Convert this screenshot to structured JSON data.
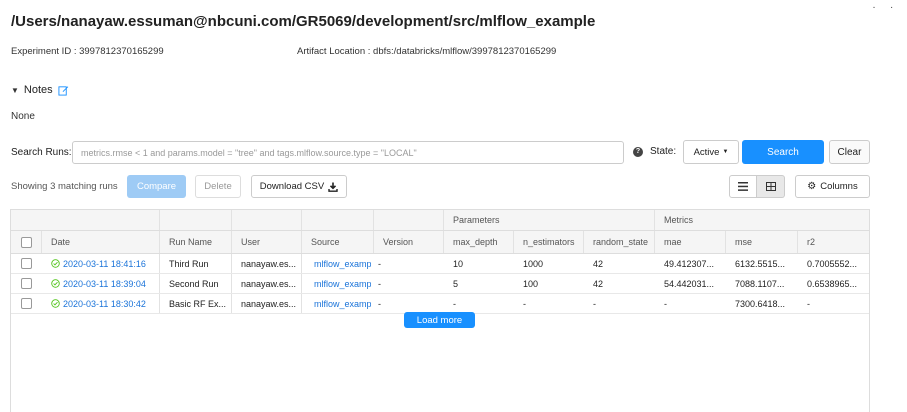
{
  "page": {
    "title": "/Users/nanayaw.essuman@nbcuni.com/GR5069/development/src/mlflow_example",
    "experiment_id_label": "Experiment ID :",
    "experiment_id": "3997812370165299",
    "artifact_location_label": "Artifact Location :",
    "artifact_location": "dbfs:/databricks/mlflow/3997812370165299",
    "corner_dots": ". ."
  },
  "notes": {
    "label": "Notes",
    "content": "None"
  },
  "search": {
    "label": "Search Runs:",
    "placeholder": "metrics.rmse < 1 and params.model = \"tree\" and tags.mlflow.source.type = \"LOCAL\"",
    "value": "",
    "state_label": "State:",
    "state_value": "Active",
    "search_button": "Search",
    "clear_button": "Clear",
    "help_glyph": "?"
  },
  "toolbar": {
    "showing_text": "Showing 3 matching runs",
    "compare_button": "Compare",
    "delete_button": "Delete",
    "download_button": "Download CSV",
    "columns_button": "Columns"
  },
  "table": {
    "group_headers": {
      "parameters": "Parameters",
      "metrics": "Metrics"
    },
    "columns": [
      "Date",
      "Run Name",
      "User",
      "Source",
      "Version",
      "max_depth",
      "n_estimators",
      "random_state",
      "mae",
      "mse",
      "r2"
    ],
    "rows": [
      [
        "2020-03-11 18:41:16",
        "Third Run",
        "nanayaw.es...",
        "mlflow_examp",
        "-",
        "10",
        "1000",
        "42",
        "49.412307...",
        "6132.5515...",
        "0.7005552..."
      ],
      [
        "2020-03-11 18:39:04",
        "Second Run",
        "nanayaw.es...",
        "mlflow_examp",
        "-",
        "5",
        "100",
        "42",
        "54.442031...",
        "7088.1107...",
        "0.6538965..."
      ],
      [
        "2020-03-11 18:30:42",
        "Basic RF Ex...",
        "nanayaw.es...",
        "mlflow_examp",
        "-",
        "-",
        "-",
        "-",
        "-",
        "7300.6418...",
        "-"
      ]
    ],
    "load_more": "Load more"
  },
  "colors": {
    "accent": "#1890ff",
    "link": "#1a73d9",
    "success": "#52c41a"
  }
}
